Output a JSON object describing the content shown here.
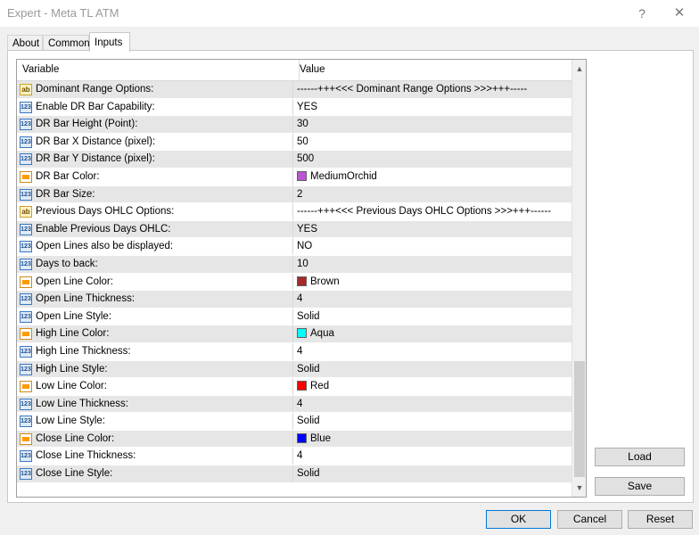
{
  "window": {
    "title": "Expert - Meta TL ATM",
    "help_glyph": "?",
    "close_glyph": "✕"
  },
  "tabs": [
    {
      "label": "About",
      "active": false
    },
    {
      "label": "Common",
      "active": false
    },
    {
      "label": "Inputs",
      "active": true
    }
  ],
  "grid": {
    "headers": {
      "variable": "Variable",
      "value": "Value"
    },
    "rows": [
      {
        "icon": "ab",
        "variable": "Dominant Range Options:",
        "value": "------+++<<< Dominant Range Options >>>+++-----"
      },
      {
        "icon": "123",
        "variable": "Enable DR Bar Capability:",
        "value": "YES"
      },
      {
        "icon": "123",
        "variable": "DR Bar Height (Point):",
        "value": "30"
      },
      {
        "icon": "123",
        "variable": "DR Bar X Distance (pixel):",
        "value": "50"
      },
      {
        "icon": "123",
        "variable": "DR Bar Y Distance (pixel):",
        "value": "500"
      },
      {
        "icon": "color",
        "variable": "DR Bar Color:",
        "value": "MediumOrchid",
        "swatch": "#BA55D3"
      },
      {
        "icon": "123",
        "variable": "DR Bar Size:",
        "value": "2"
      },
      {
        "icon": "ab",
        "variable": "Previous Days OHLC Options:",
        "value": "------+++<<< Previous Days OHLC Options >>>+++------"
      },
      {
        "icon": "123",
        "variable": "Enable Previous Days OHLC:",
        "value": "YES"
      },
      {
        "icon": "123",
        "variable": "Open Lines also be displayed:",
        "value": "NO"
      },
      {
        "icon": "123",
        "variable": "Days to back:",
        "value": "10"
      },
      {
        "icon": "color",
        "variable": "Open Line Color:",
        "value": "Brown",
        "swatch": "#A52A2A"
      },
      {
        "icon": "123",
        "variable": "Open Line Thickness:",
        "value": "4"
      },
      {
        "icon": "123",
        "variable": "Open Line Style:",
        "value": "Solid"
      },
      {
        "icon": "color",
        "variable": "High Line Color:",
        "value": "Aqua",
        "swatch": "#00FFFF"
      },
      {
        "icon": "123",
        "variable": "High Line Thickness:",
        "value": "4"
      },
      {
        "icon": "123",
        "variable": "High Line Style:",
        "value": "Solid"
      },
      {
        "icon": "color",
        "variable": "Low Line Color:",
        "value": "Red",
        "swatch": "#FF0000"
      },
      {
        "icon": "123",
        "variable": "Low Line Thickness:",
        "value": "4"
      },
      {
        "icon": "123",
        "variable": "Low Line Style:",
        "value": "Solid"
      },
      {
        "icon": "color",
        "variable": "Close Line Color:",
        "value": "Blue",
        "swatch": "#0000FF"
      },
      {
        "icon": "123",
        "variable": "Close Line Thickness:",
        "value": "4"
      },
      {
        "icon": "123",
        "variable": "Close Line Style:",
        "value": "Solid"
      }
    ]
  },
  "buttons": {
    "load": "Load",
    "save": "Save",
    "ok": "OK",
    "cancel": "Cancel",
    "reset": "Reset"
  },
  "scrollbar": {
    "up_glyph": "▲",
    "down_glyph": "▼"
  }
}
